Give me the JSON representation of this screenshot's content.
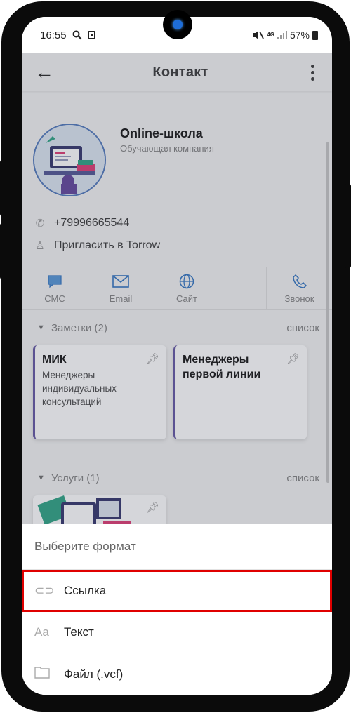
{
  "status_bar": {
    "time": "16:55",
    "network": "4G",
    "battery": "57%"
  },
  "app_bar": {
    "title": "Контакт"
  },
  "contact": {
    "name": "Online-школа",
    "subtitle": "Обучающая компания",
    "phone": "+79996665544",
    "invite": "Пригласить в Torrow"
  },
  "actions": [
    {
      "label": "СМС",
      "icon": "chat-bubble-icon"
    },
    {
      "label": "Email",
      "icon": "envelope-icon"
    },
    {
      "label": "Сайт",
      "icon": "globe-icon"
    },
    {
      "label": "Звонок",
      "icon": "phone-icon"
    }
  ],
  "notes_section": {
    "label": "Заметки (2)",
    "list_link": "список",
    "items": [
      {
        "title": "МИК",
        "body": "Менеджеры индивидуальных консультаций"
      },
      {
        "title": "Менеджеры первой линии",
        "body": ""
      }
    ]
  },
  "services_section": {
    "label": "Услуги (1)",
    "list_link": "список"
  },
  "sheet": {
    "title": "Выберите формат",
    "options": [
      {
        "label": "Ссылка",
        "icon": "link-icon",
        "icon_text": "⊂⊃"
      },
      {
        "label": "Текст",
        "icon": "text-format-icon",
        "icon_text": "Aa"
      },
      {
        "label": "Файл (.vcf)",
        "icon": "folder-icon",
        "icon_text": ""
      }
    ]
  },
  "colors": {
    "accent": "#3b7bc4",
    "highlight": "#e00000",
    "note_border": "#6b5fa8"
  }
}
